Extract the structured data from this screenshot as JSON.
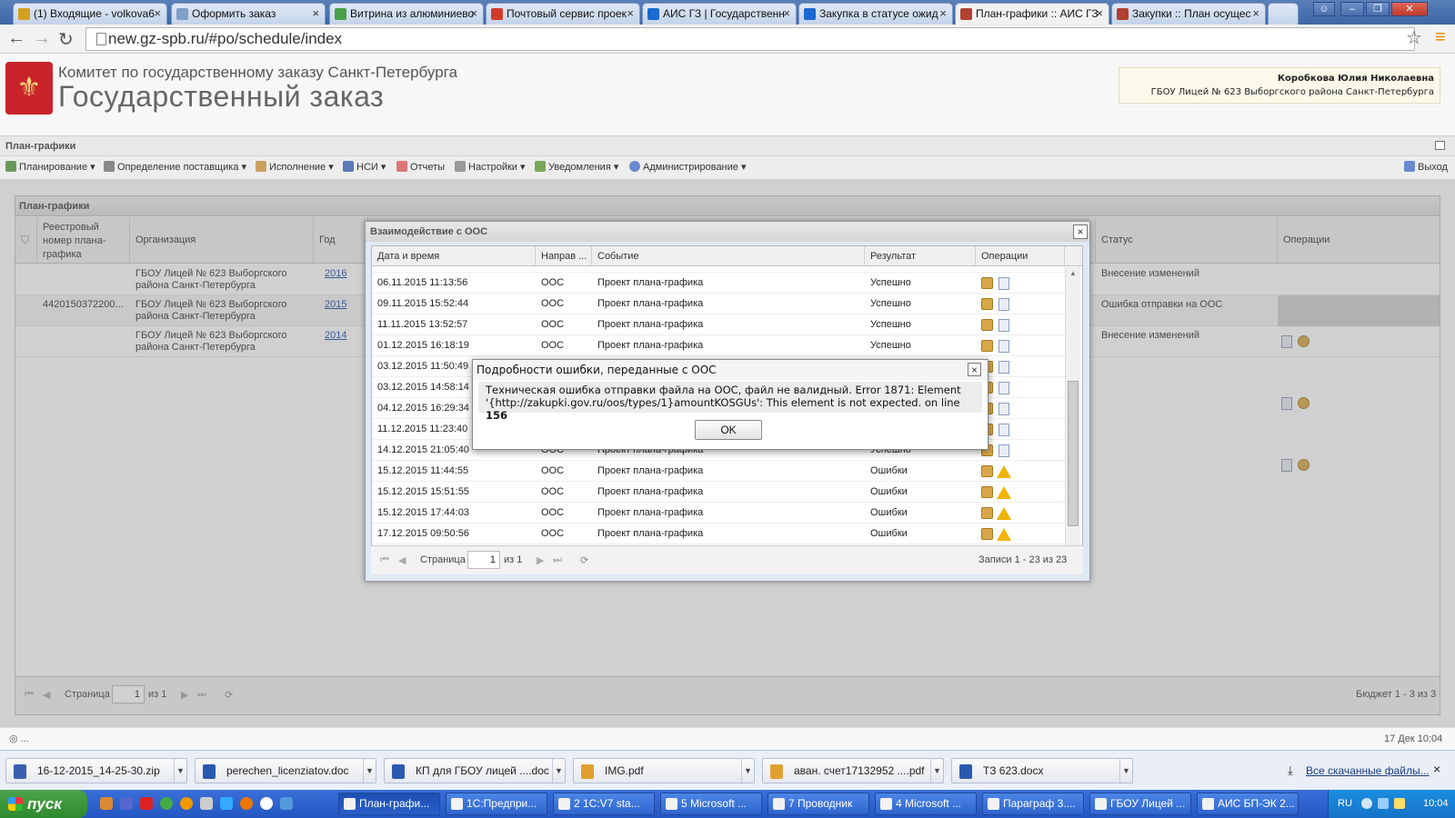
{
  "browser": {
    "tabs": [
      {
        "label": "(1) Входящие - volkova6",
        "icon_color": "#d4a020"
      },
      {
        "label": "Оформить заказ",
        "icon_color": "#7fa0c8"
      },
      {
        "label": "Витрина из алюминиево",
        "icon_color": "#4aa04a"
      },
      {
        "label": "Почтовый сервис проек",
        "icon_color": "#d23b2b"
      },
      {
        "label": "АИС ГЗ | Государственн",
        "icon_color": "#1a6ad0"
      },
      {
        "label": "Закупка в статусе ожид",
        "icon_color": "#1a6ad0"
      },
      {
        "label": "План-графики :: АИС ГЗ",
        "icon_color": "#b04030"
      },
      {
        "label": "Закупки :: План осущес",
        "icon_color": "#b04030"
      }
    ],
    "url": "new.gz-spb.ru/#po/schedule/index"
  },
  "site": {
    "subtitle": "Комитет по государственному заказу Санкт-Петербурга",
    "title": "Государственный заказ",
    "user_name": "Коробкова Юлия Николаевна",
    "user_org": "ГБОУ Лицей № 623 Выборгского района Санкт-Петербурга"
  },
  "section_title": "План-графики",
  "menu": {
    "items": [
      "Планирование",
      "Определение поставщика",
      "Исполнение",
      "НСИ",
      "Отчеты",
      "Настройки",
      "Уведомления",
      "Администрирование"
    ],
    "logout": "Выход"
  },
  "main": {
    "panel_title": "План-графики",
    "columns": {
      "reg_no": "Реестровый номер плана-графика",
      "org": "Организация",
      "year": "Год",
      "status": "Статус",
      "ops": "Операции"
    },
    "rows": [
      {
        "reg_no": "",
        "org": "ГБОУ Лицей № 623 Выборгского района Санкт-Петербурга",
        "year": "2016",
        "status_frag": "й",
        "status": "Внесение изменений"
      },
      {
        "reg_no": "4420150372200...",
        "org": "ГБОУ Лицей № 623 Выборгского района Санкт-Петербурга",
        "year": "2015",
        "status_frag": "",
        "status": "Ошибка отправки на ООС"
      },
      {
        "reg_no": "",
        "org": "ГБОУ Лицей № 623 Выборгского района Санкт-Петербурга",
        "year": "2014",
        "status_frag": "й",
        "status": "Внесение изменений"
      }
    ],
    "pager": {
      "page_label": "Страница",
      "page": "1",
      "of": "из 1",
      "summary": "Бюджет 1 - 3 из 3"
    }
  },
  "oos_window": {
    "title": "Взаимодействие с ООС",
    "columns": {
      "datetime": "Дата и время",
      "direction": "Направ ...",
      "event": "Событие",
      "result": "Результат",
      "ops": "Операции"
    },
    "rows": [
      {
        "datetime": "06.11.2015 11:13:56",
        "direction": "ООС",
        "event": "Проект плана-графика",
        "result": "Успешно",
        "warn": false
      },
      {
        "datetime": "09.11.2015 15:52:44",
        "direction": "ООС",
        "event": "Проект плана-графика",
        "result": "Успешно",
        "warn": false
      },
      {
        "datetime": "11.11.2015 13:52:57",
        "direction": "ООС",
        "event": "Проект плана-графика",
        "result": "Успешно",
        "warn": false
      },
      {
        "datetime": "01.12.2015 16:18:19",
        "direction": "ООС",
        "event": "Проект плана-графика",
        "result": "Успешно",
        "warn": false
      },
      {
        "datetime": "03.12.2015 11:50:49",
        "direction": "",
        "event": "",
        "result": "",
        "warn": false
      },
      {
        "datetime": "03.12.2015 14:58:14",
        "direction": "",
        "event": "",
        "result": "",
        "warn": false
      },
      {
        "datetime": "04.12.2015 16:29:34",
        "direction": "",
        "event": "",
        "result": "",
        "warn": false
      },
      {
        "datetime": "11.12.2015 11:23:40",
        "direction": "",
        "event": "",
        "result": "",
        "warn": false
      },
      {
        "datetime": "14.12.2015 21:05:40",
        "direction": "ООС",
        "event": "Проект плана-графика",
        "result": "Успешно",
        "warn": false
      },
      {
        "datetime": "15.12.2015 11:44:55",
        "direction": "ООС",
        "event": "Проект плана-графика",
        "result": "Ошибки",
        "warn": true
      },
      {
        "datetime": "15.12.2015 15:51:55",
        "direction": "ООС",
        "event": "Проект плана-графика",
        "result": "Ошибки",
        "warn": true
      },
      {
        "datetime": "15.12.2015 17:44:03",
        "direction": "ООС",
        "event": "Проект плана-графика",
        "result": "Ошибки",
        "warn": true
      },
      {
        "datetime": "17.12.2015 09:50:56",
        "direction": "ООС",
        "event": "Проект плана-графика",
        "result": "Ошибки",
        "warn": true
      }
    ],
    "pager": {
      "page_label": "Страница",
      "page": "1",
      "of": "из 1",
      "summary": "Записи 1 - 23 из 23"
    }
  },
  "error_dialog": {
    "title": "Подробности ошибки, переданные с ООС",
    "message_line1": "Техническая ошибка отправки файла на ООС, файл не валидный. Error 1871: Element",
    "message_line2": "'{http://zakupki.gov.ru/oos/types/1}amountKOSGUs': This element is not expected. on line ",
    "line_number": "156",
    "ok_label": "OK"
  },
  "status_line": {
    "left": "◎ ...",
    "right": "17 Дек 10:04"
  },
  "downloads": {
    "items": [
      "16-12-2015_14-25-30.zip",
      "perechen_licenziatov.doc",
      "КП для ГБОУ лицей ....doc",
      "IMG.pdf",
      "аван. счет17132952 ....pdf",
      "ТЗ 623.docx"
    ],
    "all_label": "Все скачанные файлы..."
  },
  "taskbar": {
    "start": "пуск",
    "items": [
      "План-графи...",
      "1С:Предпри...",
      "2 1С:V7 sta...",
      "5 Microsoft ...",
      "7 Проводник",
      "4 Microsoft ...",
      "Параграф 3....",
      "ГБОУ Лицей ...",
      "АИС БП-ЭК 2..."
    ],
    "lang": "RU",
    "clock": "10:04"
  }
}
